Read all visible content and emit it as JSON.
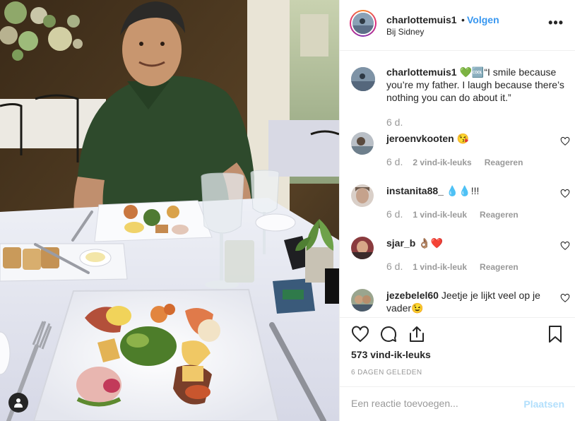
{
  "post": {
    "username": "charlottemuis1",
    "follow_label": "Volgen",
    "separator": "•",
    "location": "Bij Sidney",
    "more_icon": "more-options-icon",
    "more_glyph": "•••"
  },
  "caption": {
    "username": "charlottemuis1",
    "emoji": "💚🆒",
    "text": "“I smile because you’re my father. I laugh because there’s nothing you can do about it.”",
    "time": "6 d."
  },
  "comments": [
    {
      "username": "jeroenvkooten",
      "text": "😘",
      "time": "",
      "likes": "",
      "reply": ""
    },
    {
      "username": "",
      "text": "",
      "time": "6 d.",
      "likes": "2 vind-ik-leuks",
      "reply": "Reageren"
    },
    {
      "username": "instanita88_",
      "text": "💧💧!!!",
      "time": "6 d.",
      "likes": "1 vind-ik-leuk",
      "reply": "Reageren"
    },
    {
      "username": "sjar_b",
      "text": "👌🏽❤️",
      "time": "6 d.",
      "likes": "1 vind-ik-leuk",
      "reply": "Reageren"
    },
    {
      "username": "jezebelel60",
      "text": "Jeetje je lijkt veel op je vader😉",
      "time": "",
      "likes": "",
      "reply": ""
    }
  ],
  "actions": {
    "icons": [
      "heart-icon",
      "comment-icon",
      "share-icon",
      "bookmark-icon"
    ],
    "likes_count": "573 vind-ik-leuks",
    "posted_ago": "6 DAGEN GELEDEN"
  },
  "add_comment": {
    "placeholder": "Een reactie toevoegen...",
    "post_label": "Plaatsen"
  },
  "photo": {
    "user_tag_icon": "user-tag-icon"
  },
  "colors": {
    "link_blue": "#3897f0",
    "post_disabled": "#b2dffc",
    "meta_gray": "#999999",
    "heart_red": "#ed4956"
  }
}
